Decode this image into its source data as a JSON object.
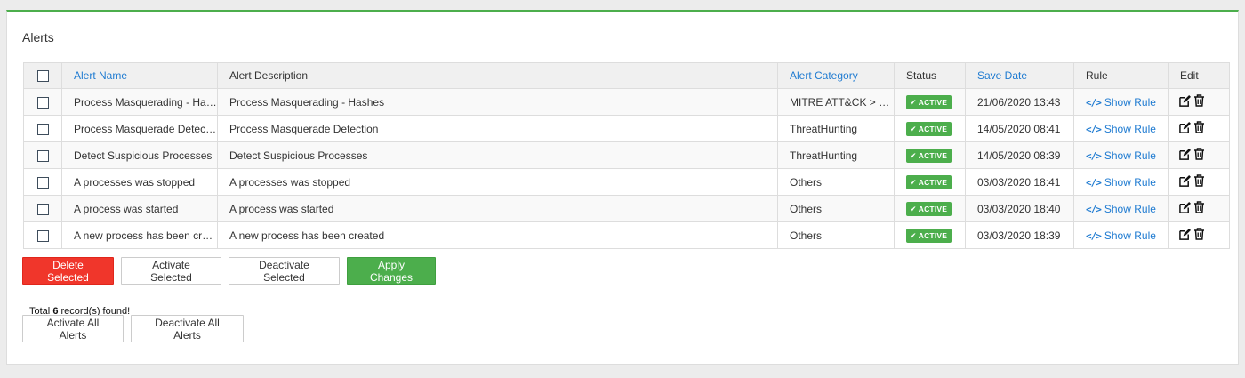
{
  "panel": {
    "title": "Alerts"
  },
  "table": {
    "headers": {
      "name": "Alert Name",
      "description": "Alert Description",
      "category": "Alert Category",
      "status": "Status",
      "save_date": "Save Date",
      "rule": "Rule",
      "edit": "Edit"
    },
    "rows": [
      {
        "name": "Process Masquerading - Hashes",
        "description": "Process Masquerading - Hashes",
        "category": "MITRE ATT&CK > Defense Evasion",
        "status": "ACTIVE",
        "save_date": "21/06/2020 13:43",
        "rule": "Show Rule"
      },
      {
        "name": "Process Masquerade Detection",
        "description": "Process Masquerade Detection",
        "category": "ThreatHunting",
        "status": "ACTIVE",
        "save_date": "14/05/2020 08:41",
        "rule": "Show Rule"
      },
      {
        "name": "Detect Suspicious Processes",
        "description": "Detect Suspicious Processes",
        "category": "ThreatHunting",
        "status": "ACTIVE",
        "save_date": "14/05/2020 08:39",
        "rule": "Show Rule"
      },
      {
        "name": "A processes was stopped",
        "description": "A processes was stopped",
        "category": "Others",
        "status": "ACTIVE",
        "save_date": "03/03/2020 18:41",
        "rule": "Show Rule"
      },
      {
        "name": "A process was started",
        "description": "A process was started",
        "category": "Others",
        "status": "ACTIVE",
        "save_date": "03/03/2020 18:40",
        "rule": "Show Rule"
      },
      {
        "name": "A new process has been created",
        "description": "A new process has been created",
        "category": "Others",
        "status": "ACTIVE",
        "save_date": "03/03/2020 18:39",
        "rule": "Show Rule"
      }
    ]
  },
  "actions": {
    "delete_selected": "Delete Selected",
    "activate_selected": "Activate Selected",
    "deactivate_selected": "Deactivate Selected",
    "apply_changes": "Apply Changes",
    "activate_all": "Activate All Alerts",
    "deactivate_all": "Deactivate All Alerts"
  },
  "footer": {
    "total_prefix": "Total",
    "total_count": "6",
    "total_suffix": "record(s) found!"
  },
  "colors": {
    "accent_green": "#4cae4c",
    "danger_red": "#f0362b",
    "link_blue": "#1f7bd1"
  },
  "icons": {
    "status": "check-icon",
    "rule": "code-icon",
    "edit": "edit-icon",
    "delete": "trash-icon"
  }
}
